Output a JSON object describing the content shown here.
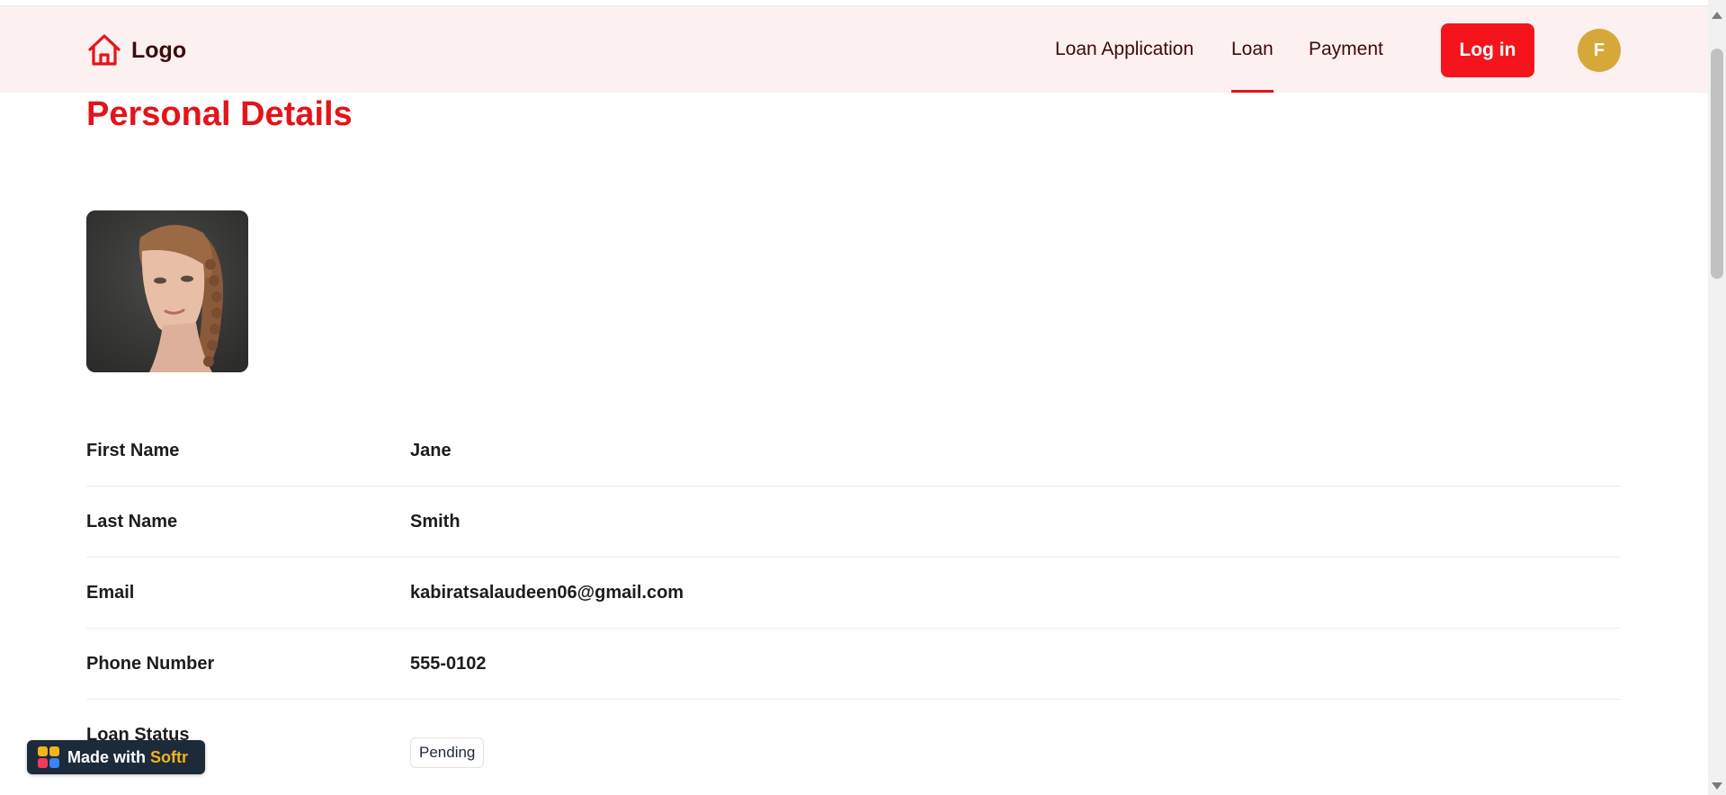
{
  "header": {
    "logo_text": "Logo",
    "logo_icon": "house-icon",
    "nav": [
      {
        "label": "Loan Application",
        "active": false
      },
      {
        "label": "Loan",
        "active": true
      },
      {
        "label": "Payment",
        "active": false
      }
    ],
    "login_label": "Log in",
    "avatar_initial": "F"
  },
  "page": {
    "title": "Personal Details"
  },
  "details": [
    {
      "label": "First Name",
      "value": "Jane"
    },
    {
      "label": "Last Name",
      "value": "Smith"
    },
    {
      "label": "Email",
      "value": "kabiratsalaudeen06@gmail.com"
    },
    {
      "label": "Phone Number",
      "value": "555-0102"
    },
    {
      "label": "Loan Status",
      "value": "Pending"
    }
  ],
  "badge": {
    "prefix": "Made with",
    "brand": "Softr"
  },
  "colors": {
    "accent": "#e3141b",
    "button": "#f5141b",
    "header_bg": "#fdf0f0",
    "avatar": "#d6a83a",
    "softr_badge_bg": "#1d2a3a",
    "softr_brand": "#f2b31f"
  }
}
